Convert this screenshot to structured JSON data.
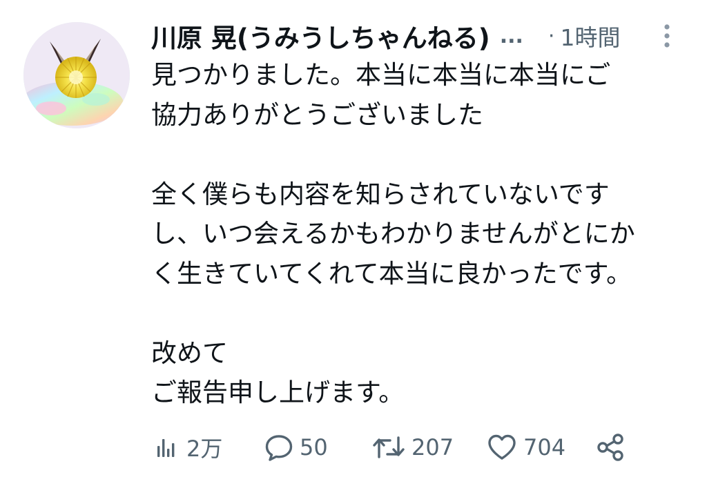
{
  "tweet": {
    "display_name": "川原 晃(うみうしちゃんねる)",
    "name_overflow": "...",
    "separator": "·",
    "timestamp": "1時間",
    "body_lines": [
      "見つかりました。本当に本当に本当にご",
      "協力ありがとうございました",
      "",
      "全く僕らも内容を知らされていないです",
      "し、いつ会えるかもわかりませんがとにか",
      "く生きていてくれて本当に良かったです。",
      "",
      "改めて",
      "ご報告申し上げます。"
    ]
  },
  "actions": {
    "views": {
      "icon": "analytics-icon",
      "count": "2万"
    },
    "replies": {
      "icon": "reply-bubble-icon",
      "count": "50"
    },
    "retweets": {
      "icon": "retweet-icon",
      "count": "207"
    },
    "likes": {
      "icon": "heart-icon",
      "count": "704"
    },
    "share": {
      "icon": "share-icon"
    }
  },
  "colors": {
    "text": "#0f1419",
    "secondary": "#536471",
    "background": "#ffffff"
  }
}
